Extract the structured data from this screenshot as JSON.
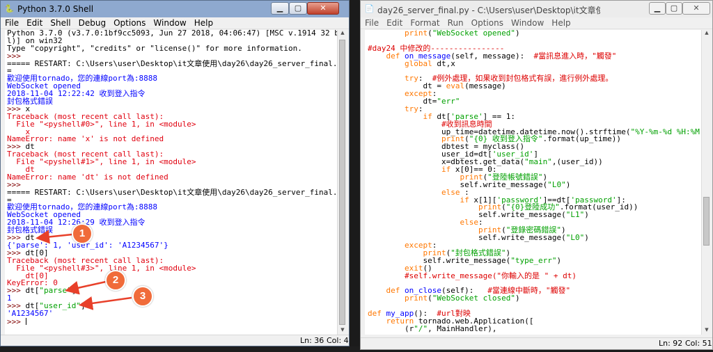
{
  "shell": {
    "title": "Python 3.7.0 Shell",
    "menu": [
      "File",
      "Edit",
      "Shell",
      "Debug",
      "Options",
      "Window",
      "Help"
    ],
    "lines": [
      {
        "s": [
          {
            "c": "def",
            "t": "Python 3.7.0 (v3.7.0:1bf9cc5093, Jun 27 2018, 04:06:47) [MSC v.1914 32 bit (Inte"
          }
        ]
      },
      {
        "s": [
          {
            "c": "def",
            "t": "l)] on win32"
          }
        ]
      },
      {
        "s": [
          {
            "c": "def",
            "t": "Type \"copyright\", \"credits\" or \"license()\" for more information."
          }
        ]
      },
      {
        "s": [
          {
            "c": "sep",
            "t": ">>> "
          }
        ]
      },
      {
        "s": [
          {
            "c": "def",
            "t": "===== RESTART: C:\\Users\\user\\Desktop\\it文章使用\\day26\\day26_server_final.py ===="
          }
        ]
      },
      {
        "s": [
          {
            "c": "def",
            "t": "="
          }
        ]
      },
      {
        "s": [
          {
            "c": "out",
            "t": "歡迎使用tornado，您的連線port為:8888"
          }
        ]
      },
      {
        "s": [
          {
            "c": "out",
            "t": "WebSocket opened"
          }
        ]
      },
      {
        "s": [
          {
            "c": "out",
            "t": "2018-11-04 12:22:42 收到登入指令"
          }
        ]
      },
      {
        "s": [
          {
            "c": "out",
            "t": "封包格式錯誤"
          }
        ]
      },
      {
        "s": [
          {
            "c": "sep",
            "t": ">>> "
          },
          {
            "c": "def",
            "t": "x"
          }
        ]
      },
      {
        "s": [
          {
            "c": "err",
            "t": "Traceback (most recent call last):"
          }
        ]
      },
      {
        "s": [
          {
            "c": "err",
            "t": "  File \"<pyshell#0>\", line 1, in <module>"
          }
        ]
      },
      {
        "s": [
          {
            "c": "err",
            "t": "    x"
          }
        ]
      },
      {
        "s": [
          {
            "c": "err",
            "t": "NameError: name 'x' is not defined"
          }
        ]
      },
      {
        "s": [
          {
            "c": "sep",
            "t": ">>> "
          },
          {
            "c": "def",
            "t": "dt"
          }
        ]
      },
      {
        "s": [
          {
            "c": "err",
            "t": "Traceback (most recent call last):"
          }
        ]
      },
      {
        "s": [
          {
            "c": "err",
            "t": "  File \"<pyshell#1>\", line 1, in <module>"
          }
        ]
      },
      {
        "s": [
          {
            "c": "err",
            "t": "    dt"
          }
        ]
      },
      {
        "s": [
          {
            "c": "err",
            "t": "NameError: name 'dt' is not defined"
          }
        ]
      },
      {
        "s": [
          {
            "c": "sep",
            "t": ">>> "
          }
        ]
      },
      {
        "s": [
          {
            "c": "def",
            "t": "===== RESTART: C:\\Users\\user\\Desktop\\it文章使用\\day26\\day26_server_final.py ===="
          }
        ]
      },
      {
        "s": [
          {
            "c": "def",
            "t": "="
          }
        ]
      },
      {
        "s": [
          {
            "c": "out",
            "t": "歡迎使用tornado，您的連線port為:8888"
          }
        ]
      },
      {
        "s": [
          {
            "c": "out",
            "t": "WebSocket opened"
          }
        ]
      },
      {
        "s": [
          {
            "c": "out",
            "t": "2018-11-04 12:26:29 收到登入指令"
          }
        ]
      },
      {
        "s": [
          {
            "c": "out",
            "t": "封包格式錯誤"
          }
        ]
      },
      {
        "s": [
          {
            "c": "sep",
            "t": ">>> "
          },
          {
            "c": "def",
            "t": "dt"
          }
        ]
      },
      {
        "s": [
          {
            "c": "out",
            "t": "{'parse': 1, 'user_id': 'A1234567'}"
          }
        ]
      },
      {
        "s": [
          {
            "c": "sep",
            "t": ">>> "
          },
          {
            "c": "def",
            "t": "dt[0]"
          }
        ]
      },
      {
        "s": [
          {
            "c": "err",
            "t": "Traceback (most recent call last):"
          }
        ]
      },
      {
        "s": [
          {
            "c": "err",
            "t": "  File \"<pyshell#3>\", line 1, in <module>"
          }
        ]
      },
      {
        "s": [
          {
            "c": "err",
            "t": "    dt[0]"
          }
        ]
      },
      {
        "s": [
          {
            "c": "err",
            "t": "KeyError: 0"
          }
        ]
      },
      {
        "s": [
          {
            "c": "sep",
            "t": ">>> "
          },
          {
            "c": "def",
            "t": "dt["
          },
          {
            "c": "str",
            "t": "\"parse\""
          },
          {
            "c": "def",
            "t": "]"
          }
        ]
      },
      {
        "s": [
          {
            "c": "out",
            "t": "1"
          }
        ]
      },
      {
        "s": [
          {
            "c": "sep",
            "t": ">>> "
          },
          {
            "c": "def",
            "t": "dt["
          },
          {
            "c": "str",
            "t": "\"user_id\""
          },
          {
            "c": "def",
            "t": "]"
          }
        ]
      },
      {
        "s": [
          {
            "c": "out",
            "t": "'A1234567'"
          }
        ]
      },
      {
        "s": [
          {
            "c": "sep",
            "t": ">>> "
          }
        ],
        "cursor": true
      }
    ],
    "status": {
      "line": "Ln: 36",
      "col": "Col: 4"
    }
  },
  "editor": {
    "title": "day26_server_final.py - C:\\Users\\user\\Desktop\\it文章使用\\day26\\day26_server_fi...",
    "menu": [
      "File",
      "Edit",
      "Format",
      "Run",
      "Options",
      "Window",
      "Help"
    ],
    "lines": [
      {
        "s": [
          {
            "c": "def",
            "t": "        "
          },
          {
            "c": "kw",
            "t": "print"
          },
          {
            "c": "def",
            "t": "("
          },
          {
            "c": "str",
            "t": "\"WebSocket opened\""
          },
          {
            "c": "def",
            "t": ")"
          }
        ]
      },
      {
        "s": []
      },
      {
        "s": [
          {
            "c": "com",
            "t": "#day24 中修改的----------------"
          }
        ]
      },
      {
        "s": [
          {
            "c": "def",
            "t": "    "
          },
          {
            "c": "kw",
            "t": "def"
          },
          {
            "c": "def",
            "t": " "
          },
          {
            "c": "fn",
            "t": "on_message"
          },
          {
            "c": "def",
            "t": "(self, message):  "
          },
          {
            "c": "com",
            "t": "#當訊息進入時，\"觸發\""
          }
        ]
      },
      {
        "s": [
          {
            "c": "def",
            "t": "        "
          },
          {
            "c": "kw",
            "t": "global"
          },
          {
            "c": "def",
            "t": " dt,x"
          }
        ]
      },
      {
        "s": []
      },
      {
        "s": [
          {
            "c": "def",
            "t": "        "
          },
          {
            "c": "kw",
            "t": "try"
          },
          {
            "c": "def",
            "t": ":  "
          },
          {
            "c": "com",
            "t": "#例外處理，如果收到封包格式有誤，進行例外處理。"
          }
        ]
      },
      {
        "s": [
          {
            "c": "def",
            "t": "            dt = "
          },
          {
            "c": "kw",
            "t": "eval"
          },
          {
            "c": "def",
            "t": "(message)"
          }
        ]
      },
      {
        "s": [
          {
            "c": "def",
            "t": "        "
          },
          {
            "c": "kw",
            "t": "except"
          },
          {
            "c": "def",
            "t": ":"
          }
        ]
      },
      {
        "s": [
          {
            "c": "def",
            "t": "            dt="
          },
          {
            "c": "str",
            "t": "\"err\""
          }
        ]
      },
      {
        "s": [
          {
            "c": "def",
            "t": "        "
          },
          {
            "c": "kw",
            "t": "try"
          },
          {
            "c": "def",
            "t": ":"
          }
        ]
      },
      {
        "s": [
          {
            "c": "def",
            "t": "            "
          },
          {
            "c": "kw",
            "t": "if"
          },
          {
            "c": "def",
            "t": " dt["
          },
          {
            "c": "str",
            "t": "'parse'"
          },
          {
            "c": "def",
            "t": "] == 1:"
          }
        ]
      },
      {
        "s": [
          {
            "c": "def",
            "t": "                "
          },
          {
            "c": "com",
            "t": "#收到訊息時間"
          }
        ]
      },
      {
        "s": [
          {
            "c": "def",
            "t": "                up_time=datetime.datetime.now().strftime("
          },
          {
            "c": "str",
            "t": "\"%Y-%m-%d %H:%M:%S\""
          },
          {
            "c": "def",
            "t": ")"
          }
        ]
      },
      {
        "s": [
          {
            "c": "def",
            "t": "                "
          },
          {
            "c": "kw",
            "t": "print"
          },
          {
            "c": "def",
            "t": "("
          },
          {
            "c": "str",
            "t": "\"{0} 收到登入指令\""
          },
          {
            "c": "def",
            "t": ".format(up_time))"
          }
        ]
      },
      {
        "s": [
          {
            "c": "def",
            "t": "                dbtest = myclass()"
          }
        ]
      },
      {
        "s": [
          {
            "c": "def",
            "t": "                user_id=dt["
          },
          {
            "c": "str",
            "t": "'user_id'"
          },
          {
            "c": "def",
            "t": "]"
          }
        ]
      },
      {
        "s": [
          {
            "c": "def",
            "t": "                x=dbtest.get_data("
          },
          {
            "c": "str",
            "t": "\"main\""
          },
          {
            "c": "def",
            "t": ",(user_id))"
          }
        ]
      },
      {
        "s": [
          {
            "c": "def",
            "t": "                "
          },
          {
            "c": "kw",
            "t": "if"
          },
          {
            "c": "def",
            "t": " x[0]== 0:"
          }
        ]
      },
      {
        "s": [
          {
            "c": "def",
            "t": "                    "
          },
          {
            "c": "kw",
            "t": "print"
          },
          {
            "c": "def",
            "t": "("
          },
          {
            "c": "str",
            "t": "\"登陸帳號錯誤\""
          },
          {
            "c": "def",
            "t": ")"
          }
        ]
      },
      {
        "s": [
          {
            "c": "def",
            "t": "                    self.write_message("
          },
          {
            "c": "str",
            "t": "\"L0\""
          },
          {
            "c": "def",
            "t": ")"
          }
        ]
      },
      {
        "s": [
          {
            "c": "def",
            "t": "                "
          },
          {
            "c": "kw",
            "t": "else"
          },
          {
            "c": "def",
            "t": " :"
          }
        ]
      },
      {
        "s": [
          {
            "c": "def",
            "t": "                    "
          },
          {
            "c": "kw",
            "t": "if"
          },
          {
            "c": "def",
            "t": " x[1]["
          },
          {
            "c": "str",
            "t": "'password'"
          },
          {
            "c": "def",
            "t": "]==dt["
          },
          {
            "c": "str",
            "t": "'password'"
          },
          {
            "c": "def",
            "t": "]:"
          }
        ]
      },
      {
        "s": [
          {
            "c": "def",
            "t": "                        "
          },
          {
            "c": "kw",
            "t": "print"
          },
          {
            "c": "def",
            "t": "("
          },
          {
            "c": "str",
            "t": "\"{0}登陸成功\""
          },
          {
            "c": "def",
            "t": ".format(user_id))"
          }
        ]
      },
      {
        "s": [
          {
            "c": "def",
            "t": "                        self.write_message("
          },
          {
            "c": "str",
            "t": "\"L1\""
          },
          {
            "c": "def",
            "t": ")"
          }
        ]
      },
      {
        "s": [
          {
            "c": "def",
            "t": "                    "
          },
          {
            "c": "kw",
            "t": "else"
          },
          {
            "c": "def",
            "t": ":"
          }
        ]
      },
      {
        "s": [
          {
            "c": "def",
            "t": "                        "
          },
          {
            "c": "kw",
            "t": "print"
          },
          {
            "c": "def",
            "t": "("
          },
          {
            "c": "str",
            "t": "\"登錄密碼錯誤\""
          },
          {
            "c": "def",
            "t": ")"
          }
        ]
      },
      {
        "s": [
          {
            "c": "def",
            "t": "                        self.write_message("
          },
          {
            "c": "str",
            "t": "\"L0\""
          },
          {
            "c": "def",
            "t": ")"
          }
        ]
      },
      {
        "s": [
          {
            "c": "def",
            "t": "        "
          },
          {
            "c": "kw",
            "t": "except"
          },
          {
            "c": "def",
            "t": ":"
          }
        ]
      },
      {
        "s": [
          {
            "c": "def",
            "t": "            "
          },
          {
            "c": "kw",
            "t": "print"
          },
          {
            "c": "def",
            "t": "("
          },
          {
            "c": "str",
            "t": "\"封包格式錯誤\""
          },
          {
            "c": "def",
            "t": ")"
          }
        ]
      },
      {
        "s": [
          {
            "c": "def",
            "t": "            self.write_message("
          },
          {
            "c": "str",
            "t": "\"type_err\""
          },
          {
            "c": "def",
            "t": ")"
          }
        ]
      },
      {
        "s": [
          {
            "c": "def",
            "t": "        "
          },
          {
            "c": "kw",
            "t": "exit"
          },
          {
            "c": "def",
            "t": "()"
          }
        ]
      },
      {
        "s": [
          {
            "c": "def",
            "t": "        "
          },
          {
            "c": "com",
            "t": "#self.write_message(\"你輸入的是 \" + dt)"
          }
        ]
      },
      {
        "s": []
      },
      {
        "s": [
          {
            "c": "def",
            "t": "    "
          },
          {
            "c": "kw",
            "t": "def"
          },
          {
            "c": "def",
            "t": " "
          },
          {
            "c": "fn",
            "t": "on_close"
          },
          {
            "c": "def",
            "t": "(self):   "
          },
          {
            "c": "com",
            "t": "#當連線中斷時，\"觸發\""
          }
        ]
      },
      {
        "s": [
          {
            "c": "def",
            "t": "        "
          },
          {
            "c": "kw",
            "t": "print"
          },
          {
            "c": "def",
            "t": "("
          },
          {
            "c": "str",
            "t": "\"WebSocket closed\""
          },
          {
            "c": "def",
            "t": ")"
          }
        ]
      },
      {
        "s": []
      },
      {
        "s": [
          {
            "c": "kw",
            "t": "def"
          },
          {
            "c": "def",
            "t": " "
          },
          {
            "c": "fn",
            "t": "my_app"
          },
          {
            "c": "def",
            "t": "():  "
          },
          {
            "c": "com",
            "t": "#url對映"
          }
        ]
      },
      {
        "s": [
          {
            "c": "def",
            "t": "    "
          },
          {
            "c": "kw",
            "t": "return"
          },
          {
            "c": "def",
            "t": " tornado.web.Application(["
          }
        ]
      },
      {
        "s": [
          {
            "c": "def",
            "t": "        (r"
          },
          {
            "c": "str",
            "t": "\"/\""
          },
          {
            "c": "def",
            "t": ", MainHandler),"
          }
        ]
      }
    ],
    "status": {
      "line": "Ln: 92",
      "col": "Col: 51"
    }
  },
  "annotations": [
    {
      "label": "1"
    },
    {
      "label": "2"
    },
    {
      "label": "3"
    }
  ],
  "colors": {
    "callout": "#f06b3a",
    "prompt": "#800000",
    "stdout": "#0000ff",
    "error": "#e0000e",
    "string": "#00a000",
    "keyword": "#ff7700",
    "comment": "#dd0000"
  },
  "icons": {
    "shell": "python-icon",
    "editor": "python-file-icon",
    "minimize": "minimize-icon",
    "maximize": "maximize-icon",
    "close": "close-icon"
  }
}
